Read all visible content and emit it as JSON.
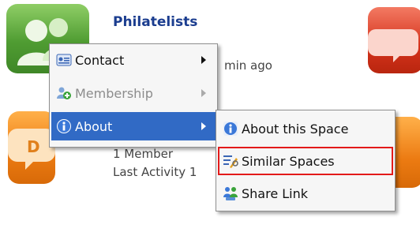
{
  "spaces": [
    {
      "title": "Philatelists",
      "activity": "min ago"
    },
    {
      "members": "1 Member",
      "activity": "Last Activity 1"
    }
  ],
  "context_menu": {
    "items": [
      {
        "label": "Contact",
        "icon": "contact-card-icon",
        "state": "normal",
        "has_submenu": true
      },
      {
        "label": "Membership",
        "icon": "membership-icon",
        "state": "disabled",
        "has_submenu": true
      },
      {
        "label": "About",
        "icon": "info-icon",
        "state": "highlighted",
        "has_submenu": true
      }
    ]
  },
  "submenu": {
    "items": [
      {
        "label": "About this Space",
        "icon": "info-icon"
      },
      {
        "label": "Similar Spaces",
        "icon": "similar-spaces-icon",
        "outlined": true
      },
      {
        "label": "Share Link",
        "icon": "share-link-icon"
      }
    ]
  },
  "colors": {
    "highlight": "#316ac5",
    "title": "#1b3d8f",
    "callout_outline": "#e31a1a"
  }
}
